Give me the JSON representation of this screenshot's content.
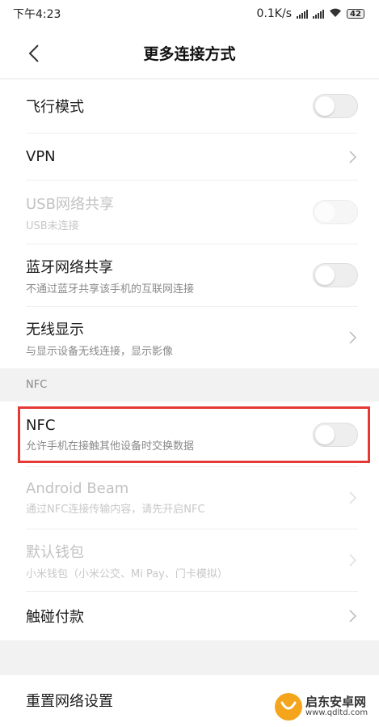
{
  "status_bar": {
    "time": "下午4:23",
    "speed": "0.1K/s",
    "battery": "42"
  },
  "header": {
    "title": "更多连接方式"
  },
  "rows": {
    "airplane": {
      "title": "飞行模式",
      "on": false
    },
    "vpn": {
      "title": "VPN"
    },
    "usb_tether": {
      "title": "USB网络共享",
      "subtitle": "USB未连接",
      "on": false,
      "disabled": true
    },
    "bt_tether": {
      "title": "蓝牙网络共享",
      "subtitle": "不通过蓝牙共享该手机的互联网连接",
      "on": false
    },
    "wireless_display": {
      "title": "无线显示",
      "subtitle": "与显示设备无线连接，显示影像"
    },
    "nfc": {
      "title": "NFC",
      "subtitle": "允许手机在接触其他设备时交换数据",
      "on": false
    },
    "android_beam": {
      "title": "Android Beam",
      "subtitle": "通过NFC连接传输内容，请先开启NFC",
      "disabled": true
    },
    "default_wallet": {
      "title": "默认钱包",
      "subtitle": "小米钱包（小米公交、Mi Pay、门卡模拟）",
      "disabled": true
    },
    "tap_pay": {
      "title": "触碰付款"
    },
    "reset_network": {
      "title": "重置网络设置"
    }
  },
  "sections": {
    "nfc_label": "NFC"
  },
  "watermark": {
    "name": "启东安卓网",
    "url": "www.qdltd.com"
  },
  "colors": {
    "highlight": "#e53935",
    "section_bg": "#f2f2f2",
    "toggle_off": "#eeeeee"
  }
}
